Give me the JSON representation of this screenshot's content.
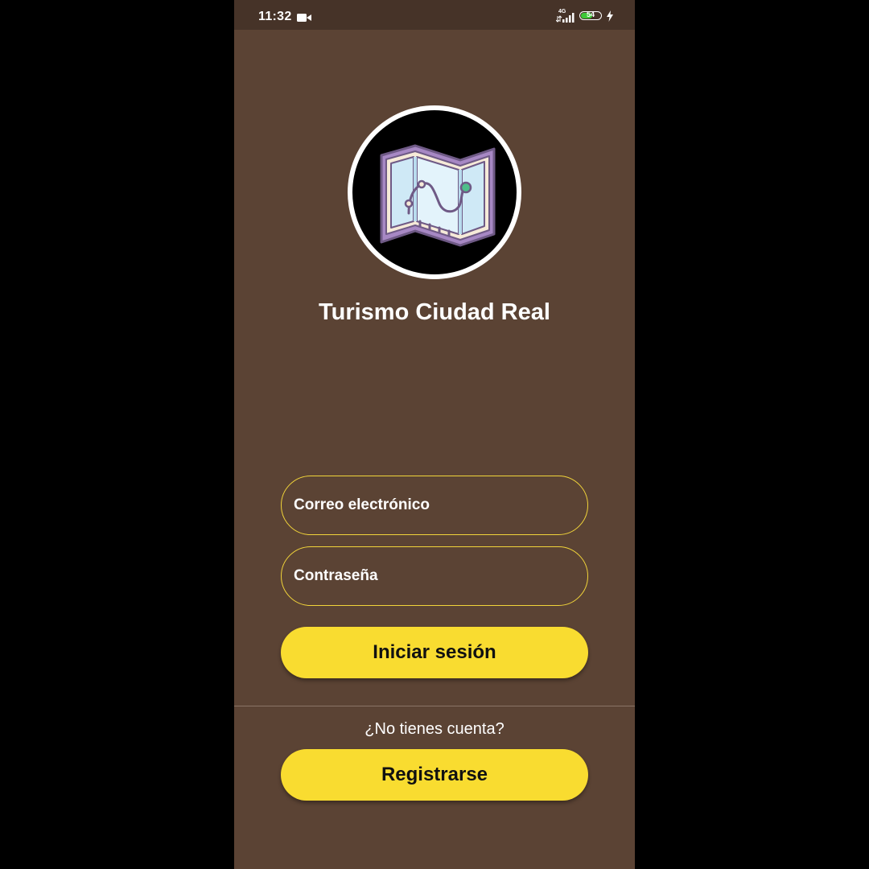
{
  "status_bar": {
    "time": "11:32",
    "network": "4G",
    "battery_level": "54",
    "icons": [
      "video-camera-icon",
      "signal-icon",
      "battery-icon",
      "charging-bolt-icon"
    ]
  },
  "app": {
    "logo_icon": "folded-map-route-icon",
    "title": "Turismo Ciudad Real"
  },
  "login_form": {
    "email_placeholder": "Correo electrónico",
    "password_placeholder": "Contraseña",
    "login_button": "Iniciar sesión"
  },
  "register_section": {
    "prompt": "¿No tienes cuenta?",
    "register_button": "Registrarse"
  },
  "colors": {
    "background": "#5b4334",
    "status_bar": "#463328",
    "accent": "#f9dc30",
    "field_border": "#f1d43a",
    "battery_fill": "#3ec837"
  }
}
